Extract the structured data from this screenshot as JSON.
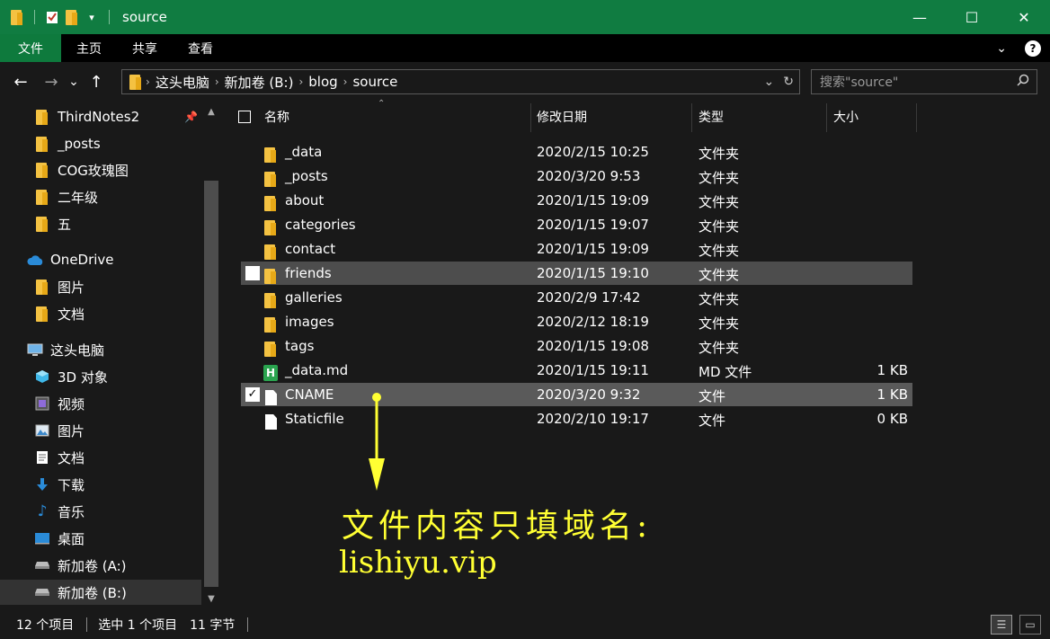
{
  "window": {
    "title": "source",
    "minimize_glyph": "—",
    "maximize_glyph": "☐",
    "close_glyph": "✕"
  },
  "ribbon": {
    "tabs": [
      "文件",
      "主页",
      "共享",
      "查看"
    ],
    "collapse_glyph": "⌄",
    "help_glyph": "?"
  },
  "nav_buttons": {
    "back": "←",
    "forward": "→",
    "recent": "⌄",
    "up": "↑"
  },
  "address": {
    "crumbs": [
      "这头电脑",
      "新加卷 (B:)",
      "blog",
      "source"
    ],
    "dropdown_glyph": "⌄",
    "refresh_glyph": "↻"
  },
  "search": {
    "placeholder": "搜索\"source\"",
    "icon": "⌕"
  },
  "nav_pane": {
    "quick_access": [
      {
        "label": "ThirdNotes2",
        "icon": "folder-icon",
        "pinned": true
      },
      {
        "label": "_posts",
        "icon": "folder-icon"
      },
      {
        "label": "COG玫瑰图",
        "icon": "folder-icon"
      },
      {
        "label": "二年级",
        "icon": "folder-icon"
      },
      {
        "label": "五",
        "icon": "folder-icon"
      }
    ],
    "onedrive": {
      "label": "OneDrive",
      "icon": "cloud-icon"
    },
    "onedrive_items": [
      {
        "label": "图片",
        "icon": "folder-icon"
      },
      {
        "label": "文档",
        "icon": "folder-icon"
      }
    ],
    "this_pc": {
      "label": "这头电脑",
      "icon": "computer-icon"
    },
    "pc_items": [
      {
        "label": "3D 对象",
        "icon": "cube-icon"
      },
      {
        "label": "视频",
        "icon": "video-icon"
      },
      {
        "label": "图片",
        "icon": "pictures-icon"
      },
      {
        "label": "文档",
        "icon": "documents-icon"
      },
      {
        "label": "下载",
        "icon": "download-icon"
      },
      {
        "label": "音乐",
        "icon": "music-icon"
      },
      {
        "label": "桌面",
        "icon": "desktop-icon"
      },
      {
        "label": "新加卷 (A:)",
        "icon": "drive-icon"
      },
      {
        "label": "新加卷 (B:)",
        "icon": "drive-icon",
        "selected": true
      }
    ]
  },
  "columns": {
    "name": "名称",
    "modified": "修改日期",
    "type": "类型",
    "size": "大小"
  },
  "files": [
    {
      "name": "_data",
      "modified": "2020/2/15 10:25",
      "type": "文件夹",
      "size": "",
      "icon": "folder-icon"
    },
    {
      "name": "_posts",
      "modified": "2020/3/20 9:53",
      "type": "文件夹",
      "size": "",
      "icon": "folder-icon"
    },
    {
      "name": "about",
      "modified": "2020/1/15 19:09",
      "type": "文件夹",
      "size": "",
      "icon": "folder-icon"
    },
    {
      "name": "categories",
      "modified": "2020/1/15 19:07",
      "type": "文件夹",
      "size": "",
      "icon": "folder-icon"
    },
    {
      "name": "contact",
      "modified": "2020/1/15 19:09",
      "type": "文件夹",
      "size": "",
      "icon": "folder-icon"
    },
    {
      "name": "friends",
      "modified": "2020/1/15 19:10",
      "type": "文件夹",
      "size": "",
      "icon": "folder-icon",
      "state": "hover"
    },
    {
      "name": "galleries",
      "modified": "2020/2/9 17:42",
      "type": "文件夹",
      "size": "",
      "icon": "folder-icon"
    },
    {
      "name": "images",
      "modified": "2020/2/12 18:19",
      "type": "文件夹",
      "size": "",
      "icon": "folder-icon"
    },
    {
      "name": "tags",
      "modified": "2020/1/15 19:08",
      "type": "文件夹",
      "size": "",
      "icon": "folder-icon"
    },
    {
      "name": "_data.md",
      "modified": "2020/1/15 19:11",
      "type": "MD 文件",
      "size": "1 KB",
      "icon": "markdown-icon"
    },
    {
      "name": "CNAME",
      "modified": "2020/3/20 9:32",
      "type": "文件",
      "size": "1 KB",
      "icon": "file-icon",
      "state": "selected"
    },
    {
      "name": "Staticfile",
      "modified": "2020/2/10 19:17",
      "type": "文件",
      "size": "0 KB",
      "icon": "file-icon"
    }
  ],
  "status": {
    "count": "12 个项目",
    "selection": "选中 1 个项目",
    "bytes": "11 字节"
  },
  "annotation": {
    "text": "文件内容只填域名:",
    "domain": "lishiyu.vip",
    "color": "#ffff33"
  },
  "colors": {
    "titlebar": "#107c41",
    "background": "#191919",
    "selected_row": "#5a5a5a",
    "folder": "#f4c242"
  }
}
